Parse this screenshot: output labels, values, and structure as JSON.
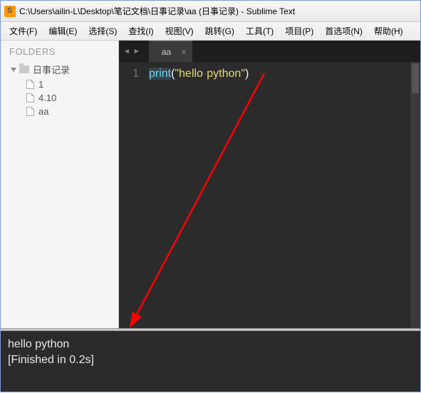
{
  "window": {
    "title": "C:\\Users\\ailin-L\\Desktop\\笔记文档\\日事记录\\aa (日事记录) - Sublime Text"
  },
  "menu": {
    "items": [
      "文件(F)",
      "编辑(E)",
      "选择(S)",
      "查找(I)",
      "视图(V)",
      "跳转(G)",
      "工具(T)",
      "项目(P)",
      "首选项(N)",
      "帮助(H)"
    ]
  },
  "sidebar": {
    "header": "FOLDERS",
    "root": "日事记录",
    "files": [
      "1",
      "4.10",
      "aa"
    ]
  },
  "tabs": {
    "active": "aa"
  },
  "code": {
    "line_number": "1",
    "func": "print",
    "open": "(",
    "str_open": "\"",
    "str_a": "hello",
    "dot": "·",
    "str_b": "python",
    "str_close": "\"",
    "close": ")"
  },
  "console": {
    "line1": "hello python",
    "line2": "[Finished in 0.2s]"
  }
}
